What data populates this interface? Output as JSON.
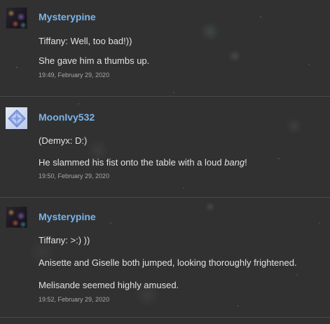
{
  "posts": [
    {
      "username": "Mysterypine",
      "avatar": "avatar-dark-starfield",
      "lines": [
        "Tiffany: Well, too bad!))",
        "She gave him a thumbs up."
      ],
      "timestamp": "19:49, February 29, 2020"
    },
    {
      "username": "MoonIvy532",
      "avatar": "avatar-blue-crystal",
      "lines": [
        "(Demyx: D:)"
      ],
      "line2": {
        "before": "He slammed his fist onto the table with a loud ",
        "emphasis": "bang",
        "after": "!"
      },
      "timestamp": "19:50, February 29, 2020"
    },
    {
      "username": "Mysterypine",
      "avatar": "avatar-dark-starfield",
      "lines": [
        "Tiffany: >:) ))",
        "Anisette and Giselle both jumped, looking thoroughly frightened.",
        "Melisande seemed highly amused."
      ],
      "timestamp": "19:52, February 29, 2020"
    }
  ],
  "colors": {
    "background": "#313131",
    "username": "#79b4ec",
    "text": "#e2e2e2",
    "timestamp": "#a8a8a8",
    "divider": "#4a4a4a"
  }
}
